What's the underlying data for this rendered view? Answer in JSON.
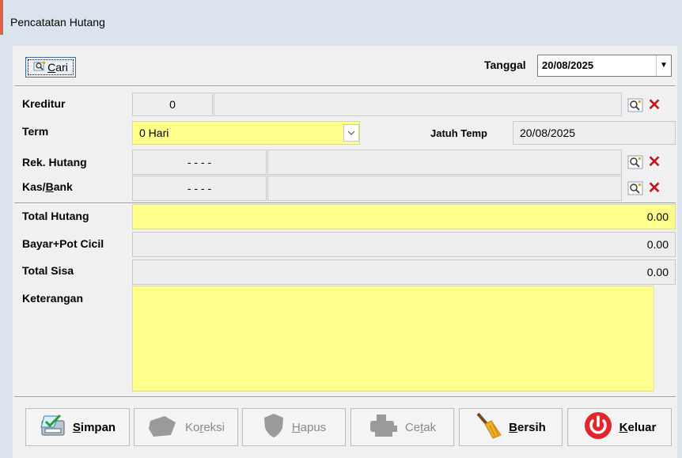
{
  "window": {
    "title": "Pencatatan Hutang"
  },
  "toolbar": {
    "cari_pre": "",
    "cari_u": "C",
    "cari_post": "ari",
    "tanggal_label": "Tanggal",
    "tanggal_value": "20/08/2025"
  },
  "fields": {
    "kreditur": {
      "label": "Kreditur",
      "code": "0",
      "name": ""
    },
    "term": {
      "label": "Term",
      "value": "0 Hari"
    },
    "jatuh_tempo": {
      "label": "Jatuh Temp",
      "value": "20/08/2025"
    },
    "rek_hutang": {
      "label": "Rek. Hutang",
      "code": "- - - -",
      "name": ""
    },
    "kas_bank": {
      "label_pre": "Kas/",
      "label_u": "B",
      "label_post": "ank",
      "code": "- - - -",
      "name": ""
    },
    "total_hutang": {
      "label": "Total Hutang",
      "value": "0.00"
    },
    "bayar_pot": {
      "label": "Bayar+Pot Cicil",
      "value": "0.00"
    },
    "total_sisa": {
      "label": "Total Sisa",
      "value": "0.00"
    },
    "keterangan": {
      "label": "Keterangan",
      "value": ""
    }
  },
  "buttons": {
    "simpan": {
      "u": "S",
      "rest": "impan"
    },
    "koreksi": {
      "pre": "Ko",
      "u": "r",
      "post": "eksi"
    },
    "hapus": {
      "u": "H",
      "rest": "apus"
    },
    "cetak": {
      "pre": "Ce",
      "u": "t",
      "post": "ak"
    },
    "bersih": {
      "u": "B",
      "rest": "ersih"
    },
    "keluar": {
      "u": "K",
      "rest": "eluar"
    }
  },
  "colors": {
    "input_yellow": "#ffff8c",
    "delete_red": "#c0181c",
    "keluar_red": "#e0282c"
  }
}
